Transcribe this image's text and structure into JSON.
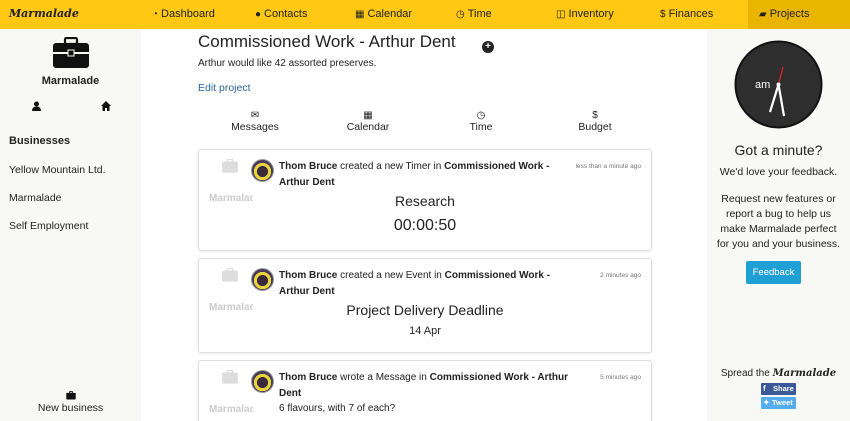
{
  "brand": "Marmalade",
  "nav": [
    {
      "label": "Dashboard",
      "icon": "dashboard-icon"
    },
    {
      "label": "Contacts",
      "icon": "user-icon"
    },
    {
      "label": "Calendar",
      "icon": "calendar-icon"
    },
    {
      "label": "Time",
      "icon": "clock-icon"
    },
    {
      "label": "Inventory",
      "icon": "cube-icon"
    },
    {
      "label": "Finances",
      "icon": "dollar-icon"
    },
    {
      "label": "Projects",
      "icon": "folder-open-icon",
      "active": true
    }
  ],
  "sidebar": {
    "business_name": "Marmalade",
    "heading": "Businesses",
    "businesses": [
      "Yellow Mountain Ltd.",
      "Marmalade",
      "Self Employment"
    ],
    "new_business": "New business"
  },
  "project": {
    "title": "Commissioned Work - Arthur Dent",
    "description": "Arthur would like 42 assorted preserves.",
    "edit_label": "Edit project",
    "tabs": [
      {
        "label": "Messages",
        "icon": "envelope-icon"
      },
      {
        "label": "Calendar",
        "icon": "calendar-icon"
      },
      {
        "label": "Time",
        "icon": "clock-icon"
      },
      {
        "label": "Budget",
        "icon": "dollar-icon"
      }
    ]
  },
  "feed": [
    {
      "business": "Marmalade",
      "user": "Thom Bruce",
      "action": "created a new Timer in",
      "target": "Commissioned Work - Arthur Dent",
      "time": "less than a minute ago",
      "title": "Research",
      "detail": "00:00:50"
    },
    {
      "business": "Marmalade",
      "user": "Thom Bruce",
      "action": "created a new Event in",
      "target": "Commissioned Work - Arthur Dent",
      "time": "2 minutes ago",
      "title": "Project Delivery Deadline",
      "detail": "14 Apr"
    },
    {
      "business": "Marmalade",
      "user": "Thom Bruce",
      "action": "wrote a Message in",
      "target": "Commissioned Work - Arthur Dent",
      "time": "5 minutes ago",
      "message": "6 flavours, with 7 of each?"
    }
  ],
  "right": {
    "clock_label": "am",
    "title": "Got a minute?",
    "subtitle": "We'd love your feedback.",
    "body": "Request new features or report a bug to help us make Marmalade perfect for you and your business.",
    "feedback_label": "Feedback",
    "spread_prefix": "Spread the",
    "spread_brand": "Marmalade",
    "share_label": "Share",
    "tweet_label": "Tweet"
  },
  "colors": {
    "nav_bg": "#ffc812",
    "nav_active": "#e9b500",
    "feedback": "#1fa0d5",
    "link": "#2a6496"
  }
}
